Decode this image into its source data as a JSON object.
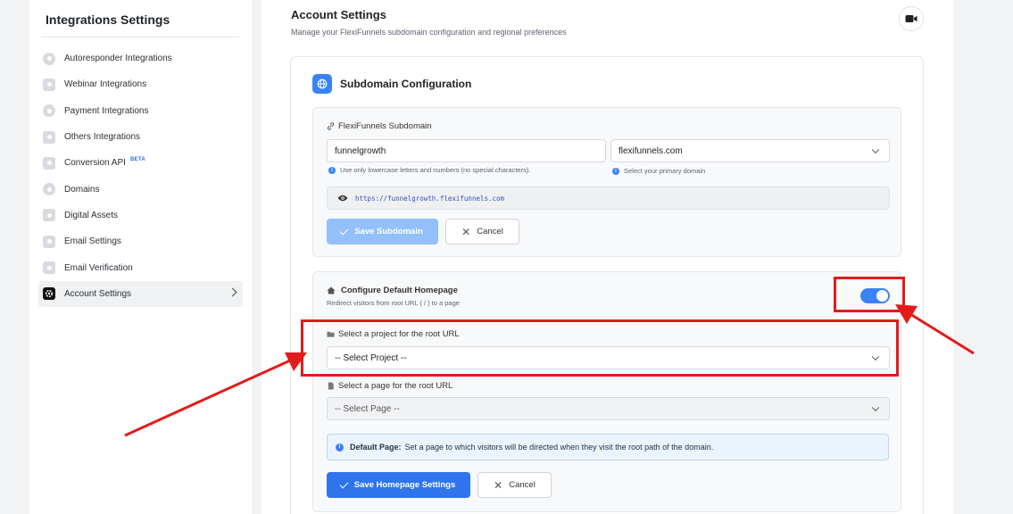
{
  "sidebar": {
    "title": "Integrations Settings",
    "items": [
      {
        "label": "Autoresponder Integrations",
        "icon": "user-icon"
      },
      {
        "label": "Webinar Integrations",
        "icon": "video-icon"
      },
      {
        "label": "Payment Integrations",
        "icon": "dollar-icon"
      },
      {
        "label": "Others Integrations",
        "icon": "file-icon"
      },
      {
        "label": "Conversion API",
        "icon": "file-icon",
        "badge": "BETA"
      },
      {
        "label": "Domains",
        "icon": "globe-icon"
      },
      {
        "label": "Digital Assets",
        "icon": "gift-icon"
      },
      {
        "label": "Email Settings",
        "icon": "mail-icon"
      },
      {
        "label": "Email Verification",
        "icon": "check-file-icon"
      },
      {
        "label": "Account Settings",
        "icon": "gear-icon",
        "active": true
      }
    ]
  },
  "header": {
    "title": "Account Settings",
    "subtitle": "Manage your FlexiFunnels subdomain configuration and regional preferences"
  },
  "subdomain": {
    "title": "Subdomain Configuration",
    "label": "FlexiFunnels Subdomain",
    "value": "funnelgrowth",
    "domain": "flexifunnels.com",
    "hint_sub": "Use only lowercase letters and numbers (no special characters).",
    "hint_domain": "Select your primary domain",
    "preview_url": "https://funnelgrowth.flexifunnels.com",
    "save_label": "Save Subdomain",
    "cancel_label": "Cancel"
  },
  "homepage": {
    "title": "Configure Default Homepage",
    "subtitle": "Redirect visitors from root URL ( / ) to a page",
    "toggle_on": true,
    "project_label": "Select a project for the root URL",
    "project_value": "-- Select Project --",
    "page_label": "Select a page for the root URL",
    "page_value": "-- Select Page --",
    "info_title": "Default Page:",
    "info_text": "Set a page to which visitors will be directed when they visit the root path of the domain.",
    "save_label": "Save Homepage Settings",
    "cancel_label": "Cancel"
  },
  "colors": {
    "accent": "#3b82f6",
    "annotation": "#e21b1b"
  }
}
